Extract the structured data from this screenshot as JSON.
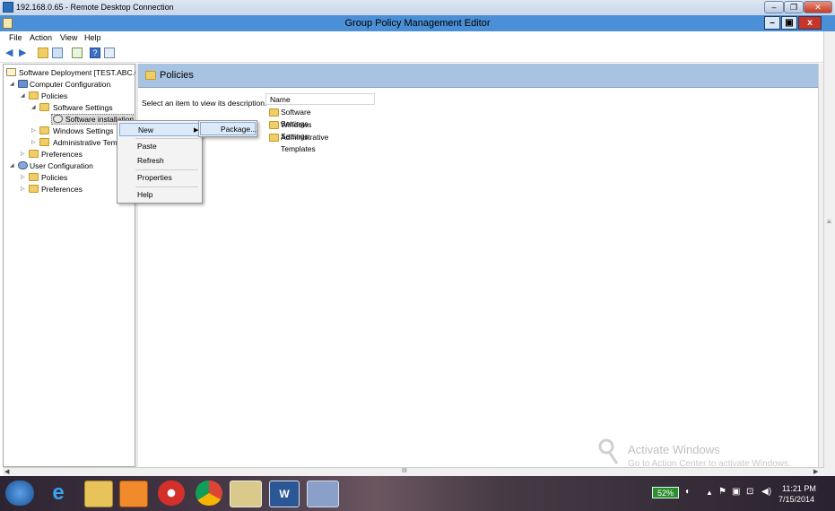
{
  "rdp": {
    "title": "192.168.0.65 - Remote Desktop Connection"
  },
  "window": {
    "title": "Group Policy Management Editor"
  },
  "menu": [
    "File",
    "Action",
    "View",
    "Help"
  ],
  "tree": {
    "root": "Software Deployment [TEST.ABC.CO",
    "computer_config": "Computer Configuration",
    "policies": "Policies",
    "software_settings": "Software Settings",
    "software_installation": "Software installation",
    "windows_settings": "Windows Settings",
    "admin_templates": "Administrative Tem",
    "preferences": "Preferences",
    "user_config": "User Configuration",
    "user_policies": "Policies",
    "user_preferences": "Preferences"
  },
  "right": {
    "header": "Policies",
    "description": "Select an item to view its description.",
    "column": "Name",
    "rows": [
      "Software Settings",
      "Windows Settings",
      "Administrative Templates"
    ]
  },
  "context_menu": {
    "new": "New",
    "paste": "Paste",
    "refresh": "Refresh",
    "properties": "Properties",
    "help": "Help",
    "submenu_package": "Package..."
  },
  "scroll": {
    "h_grip": "III"
  },
  "watermark": {
    "line1": "Activate Windows",
    "line2": "Go to Action Center to activate Windows."
  },
  "taskbar": {
    "battery": "52%",
    "time": "11:21 PM",
    "date": "7/15/2014"
  }
}
